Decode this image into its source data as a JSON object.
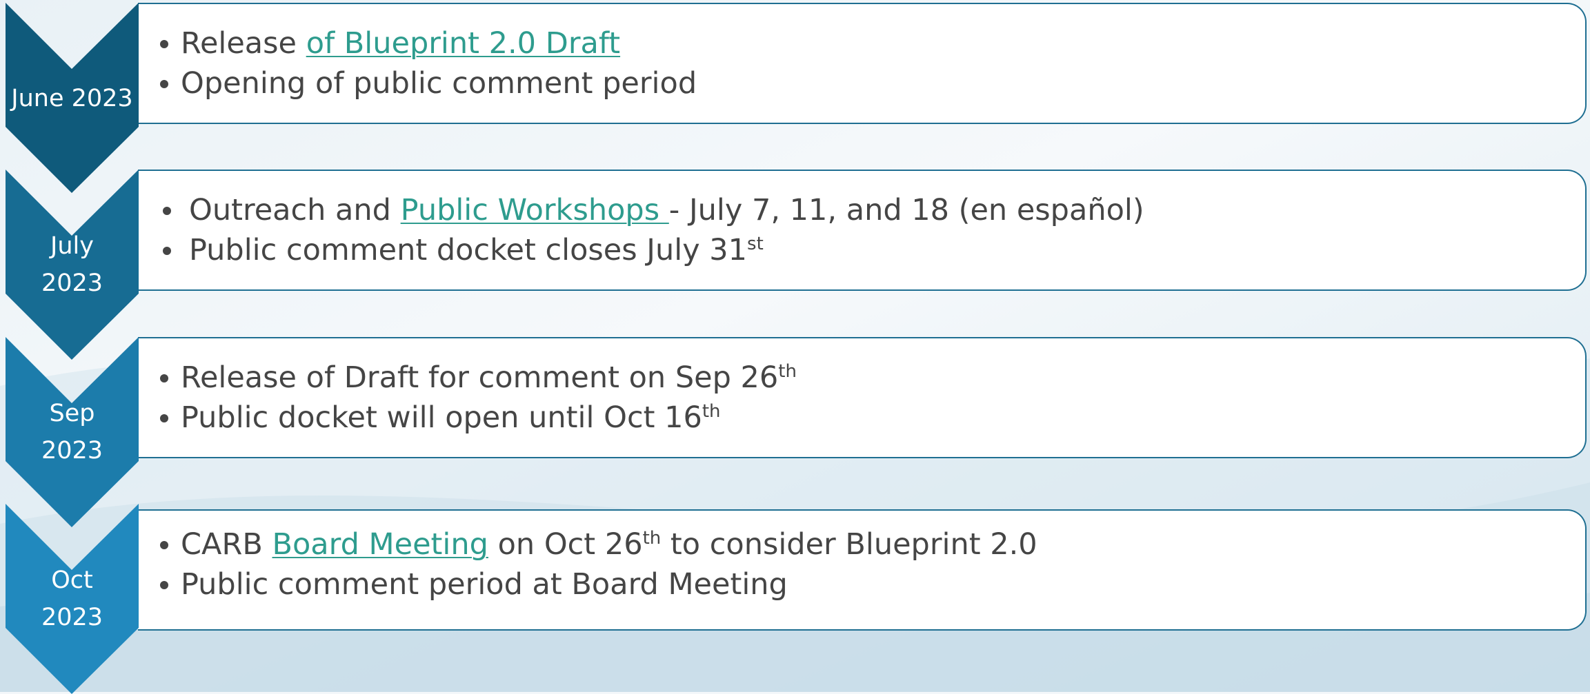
{
  "colors": {
    "chevrons": [
      "#0f5a7b",
      "#176c93",
      "#1c7cab",
      "#2189be"
    ],
    "box_border": "#1f6f92",
    "text": "#454545",
    "link": "#2e9c8e"
  },
  "timeline": [
    {
      "label": "June 2023",
      "items": [
        {
          "parts": [
            {
              "text": "Release "
            },
            {
              "text": "of Blueprint 2.0 Draft",
              "link": true
            }
          ]
        },
        {
          "parts": [
            {
              "text": "Opening of public comment period"
            }
          ]
        }
      ]
    },
    {
      "label": "July\n2023",
      "items": [
        {
          "parts": [
            {
              "text": "Outreach and "
            },
            {
              "text": "Public Workshops ",
              "link": true
            },
            {
              "text": "- July 7, 11, and 18 (en español)"
            }
          ]
        },
        {
          "parts": [
            {
              "text": "Public comment docket closes July 31"
            },
            {
              "text": "st",
              "sup": true
            }
          ]
        }
      ]
    },
    {
      "label": "Sep\n2023",
      "items": [
        {
          "parts": [
            {
              "text": "Release of Draft for comment on Sep 26"
            },
            {
              "text": "th",
              "sup": true
            }
          ]
        },
        {
          "parts": [
            {
              "text": "Public docket will open until Oct 16"
            },
            {
              "text": "th",
              "sup": true
            }
          ]
        }
      ]
    },
    {
      "label": "Oct\n2023",
      "items": [
        {
          "parts": [
            {
              "text": "CARB "
            },
            {
              "text": "Board Meeting",
              "link": true
            },
            {
              "text": " on Oct 26"
            },
            {
              "text": "th",
              "sup": true
            },
            {
              "text": " to consider Blueprint 2.0"
            }
          ]
        },
        {
          "parts": [
            {
              "text": "Public comment period at Board Meeting"
            }
          ]
        }
      ]
    }
  ]
}
